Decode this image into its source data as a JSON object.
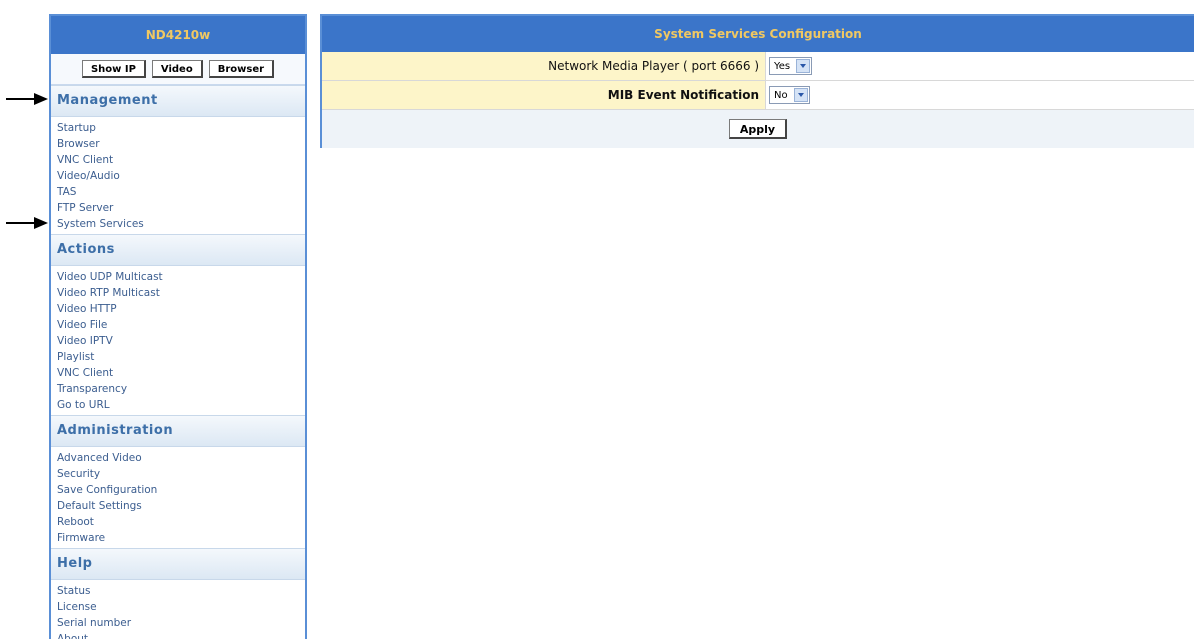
{
  "sidebar": {
    "title": "ND4210w",
    "buttons": [
      "Show IP",
      "Video",
      "Browser"
    ],
    "sections": [
      {
        "heading": "Management",
        "items": [
          "Startup",
          "Browser",
          "VNC Client",
          "Video/Audio",
          "TAS",
          "FTP Server",
          "System Services"
        ]
      },
      {
        "heading": "Actions",
        "items": [
          "Video UDP Multicast",
          "Video RTP Multicast",
          "Video HTTP",
          "Video File",
          "Video IPTV",
          "Playlist",
          "VNC Client",
          "Transparency",
          "Go to URL"
        ]
      },
      {
        "heading": "Administration",
        "items": [
          "Advanced Video",
          "Security",
          "Save Configuration",
          "Default Settings",
          "Reboot",
          "Firmware"
        ]
      },
      {
        "heading": "Help",
        "items": [
          "Status",
          "License",
          "Serial number",
          "About"
        ]
      }
    ]
  },
  "main": {
    "title": "System Services Configuration",
    "rows": [
      {
        "label": "Network Media Player ( port 6666 )",
        "value": "Yes"
      },
      {
        "label": "MIB Event Notification",
        "value": "No"
      }
    ],
    "apply_label": "Apply"
  },
  "icons": {
    "arrow": "right-arrow-icon",
    "dropdown": "chevron-down-icon"
  },
  "colors": {
    "header_bg": "#3b75c9",
    "header_text": "#f0c862",
    "label_bg": "#fdf5c9",
    "section_text": "#3d6fa8"
  }
}
